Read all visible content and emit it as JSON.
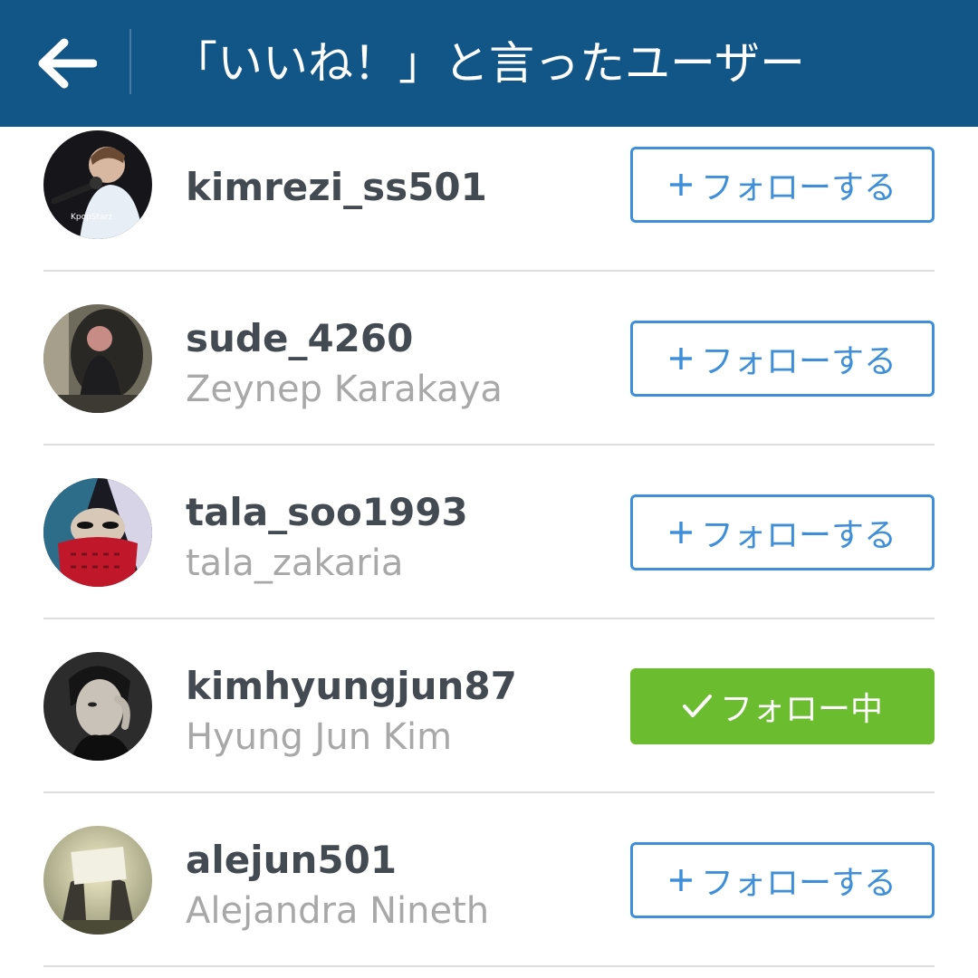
{
  "header": {
    "title": "「いいね！」と言ったユーザー",
    "back_icon": "arrow-left-icon",
    "background": "#125688"
  },
  "colors": {
    "follow_border": "#3f8fd8",
    "following_bg": "#6bbd2f",
    "username": "#444a52",
    "fullname": "#a8a8a8"
  },
  "users": [
    {
      "username": "kimrezi_ss501",
      "fullname": "",
      "button": "フォローする",
      "button_icon": "plus-icon",
      "following": false
    },
    {
      "username": "sude_4260",
      "fullname": "Zeynep Karakaya",
      "button": "フォローする",
      "button_icon": "plus-icon",
      "following": false
    },
    {
      "username": "tala_soo1993",
      "fullname": "tala_zakaria",
      "button": "フォローする",
      "button_icon": "plus-icon",
      "following": false
    },
    {
      "username": "kimhyungjun87",
      "fullname": "Hyung Jun Kim",
      "button": "フォロー中",
      "button_icon": "check-icon",
      "following": true
    },
    {
      "username": "alejun501",
      "fullname": "Alejandra Nineth",
      "button": "フォローする",
      "button_icon": "plus-icon",
      "following": false
    }
  ]
}
